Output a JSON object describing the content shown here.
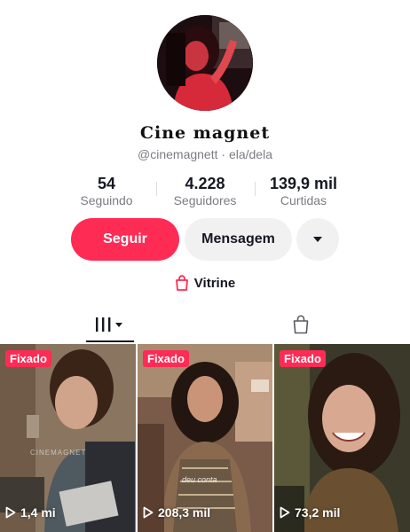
{
  "profile": {
    "display_name": "Cine magnet",
    "username": "@cinemagnett · ela/dela",
    "avatar_icon": "profile-photo"
  },
  "stats": [
    {
      "value": "54",
      "label": "Seguindo"
    },
    {
      "value": "4.228",
      "label": "Seguidores"
    },
    {
      "value": "139,9 mil",
      "label": "Curtidas"
    }
  ],
  "actions": {
    "follow_label": "Seguir",
    "message_label": "Mensagem",
    "more_icon": "caret-down-icon"
  },
  "shop": {
    "label": "Vitrine",
    "icon": "shopping-bag-icon"
  },
  "tabs": [
    {
      "icon": "grid-icon",
      "selected": true
    },
    {
      "icon": "shopping-bag-icon",
      "selected": false
    }
  ],
  "videos": [
    {
      "badge": "Fixado",
      "views": "1,4 mi",
      "watermark": "CINEMAGNET"
    },
    {
      "badge": "Fixado",
      "views": "208,3 mil",
      "caption": "deu conta"
    },
    {
      "badge": "Fixado",
      "views": "73,2 mil"
    }
  ],
  "colors": {
    "accent": "#fe2c55",
    "secondary_button": "#f1f1f2",
    "muted_text": "#7b7c82",
    "text": "#161823"
  }
}
